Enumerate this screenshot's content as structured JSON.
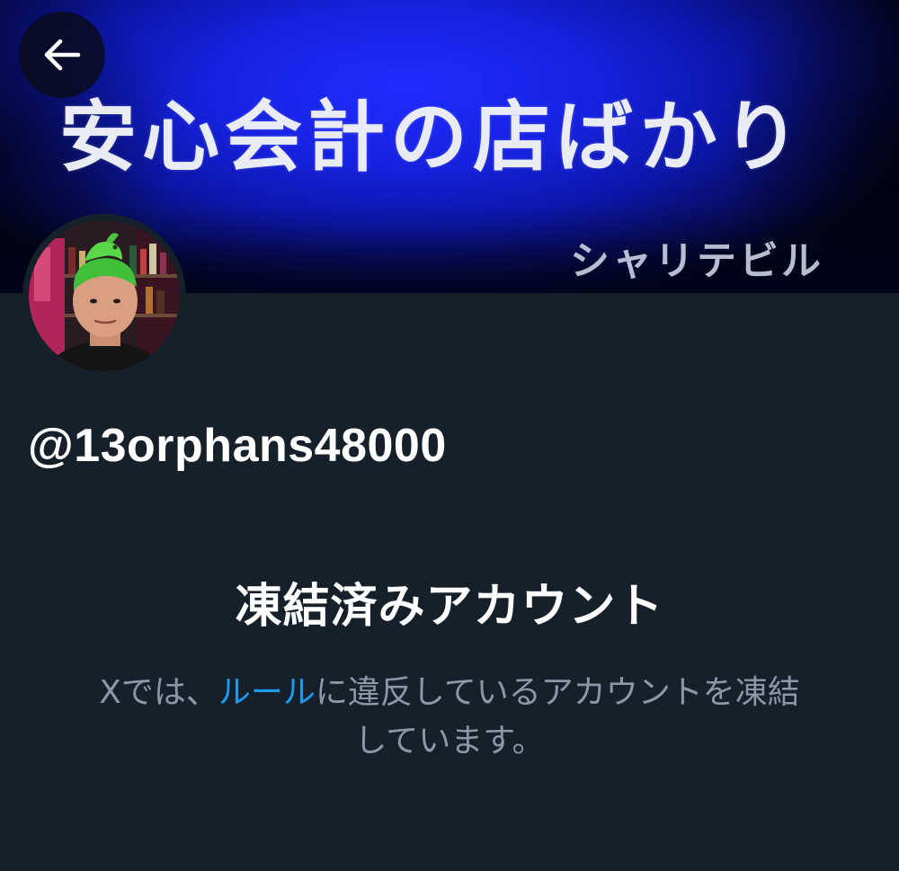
{
  "banner": {
    "sign_text": "安心会計の店ばかり",
    "building_name": "シャリテビル"
  },
  "back_button": {
    "icon": "arrow-left-icon"
  },
  "profile": {
    "avatar_icon": "avatar",
    "handle": "@13orphans48000"
  },
  "notice": {
    "title": "凍結済みアカウント",
    "body_before": "Xでは、",
    "rules_link": "ルール",
    "body_after_line1": "に違反しているアカウントを凍結",
    "body_line2": "しています。"
  },
  "colors": {
    "background": "#15202b",
    "link": "#1d9bf0",
    "secondary_text": "#8b98a5",
    "primary_text": "#ffffff"
  }
}
